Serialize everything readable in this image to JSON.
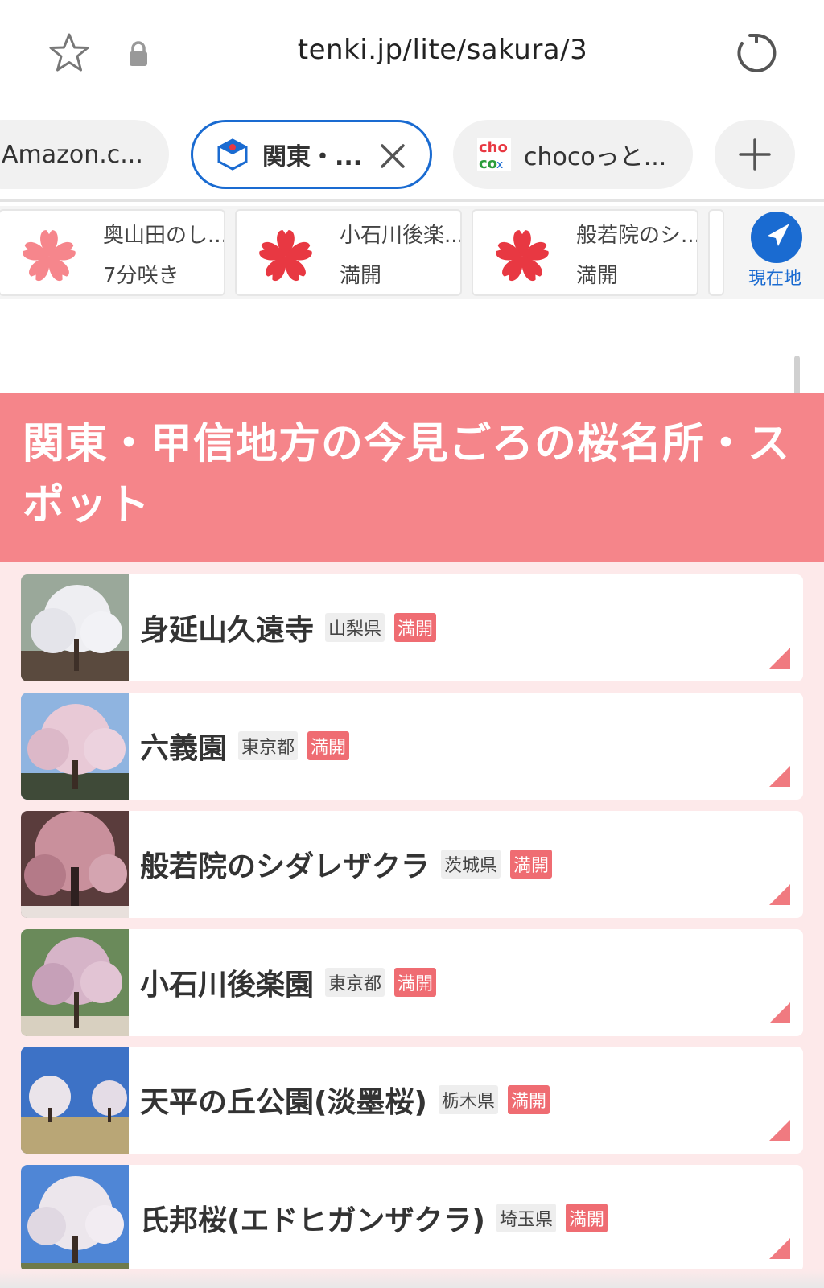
{
  "browser": {
    "url": "tenki.jp/lite/sakura/3",
    "tabs": [
      {
        "label": "Amazon.c..."
      },
      {
        "label": "関東・..."
      },
      {
        "label": "chocoっと..."
      }
    ]
  },
  "sakura_strip": {
    "cards": [
      {
        "name": "奥山田のし...",
        "status": "7分咲き",
        "color": "#f6868c"
      },
      {
        "name": "小石川後楽...",
        "status": "満開",
        "color": "#e83842"
      },
      {
        "name": "般若院のシ...",
        "status": "満開",
        "color": "#e83842"
      }
    ],
    "locate_label": "現在地"
  },
  "heading": {
    "title": "関東・甲信地方の今見ごろの桜名所・スポット"
  },
  "spots": [
    {
      "name": "身延山久遠寺",
      "pref": "山梨県",
      "status": "満開",
      "thumb": "weeping-cherry-white"
    },
    {
      "name": "六義園",
      "pref": "東京都",
      "status": "満開",
      "thumb": "weeping-cherry-pink"
    },
    {
      "name": "般若院のシダレザクラ",
      "pref": "茨城県",
      "status": "満開",
      "thumb": "weeping-cherry-dark"
    },
    {
      "name": "小石川後楽園",
      "pref": "東京都",
      "status": "満開",
      "thumb": "weeping-cherry-garden"
    },
    {
      "name": "天平の丘公園(淡墨桜)",
      "pref": "栃木県",
      "status": "満開",
      "thumb": "cherry-trees-park"
    },
    {
      "name": "氏邦桜(エドヒガンザクラ)",
      "pref": "埼玉県",
      "status": "満開",
      "thumb": "cherry-tree-sky"
    }
  ],
  "colors": {
    "accent": "#1a6bd1",
    "heading_bg": "#f5858a",
    "list_bg": "#fde9ea",
    "badge": "#ef6c72"
  }
}
